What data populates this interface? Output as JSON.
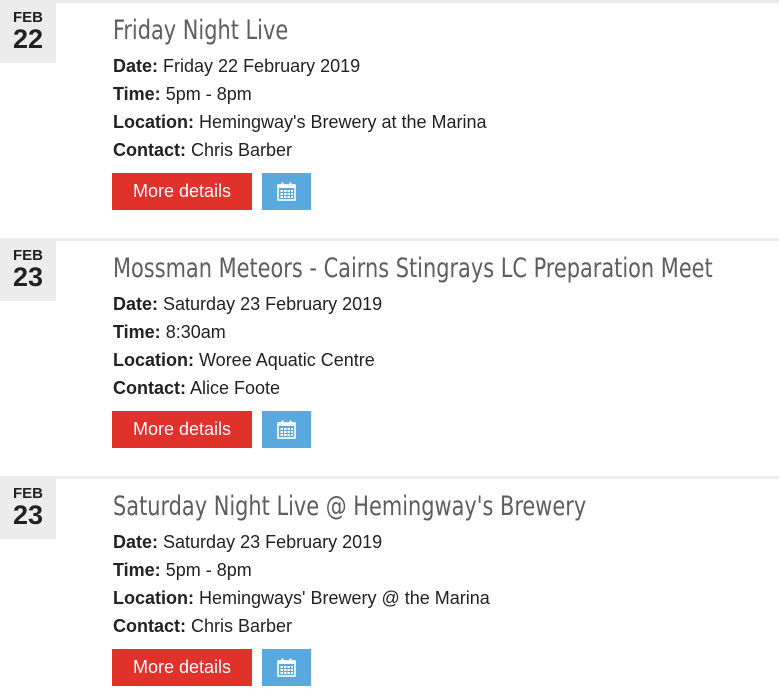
{
  "events": [
    {
      "month": "FEB",
      "day": "22",
      "title": "Friday Night Live",
      "date_label": "Date:",
      "date_value": "Friday 22 February 2019",
      "time_label": "Time:",
      "time_value": "5pm - 8pm",
      "location_label": "Location:",
      "location_value": "Hemingway's Brewery at the Marina",
      "contact_label": "Contact:",
      "contact_value": "Chris Barber",
      "more_label": "More details",
      "calendar_icon": "calendar-icon"
    },
    {
      "month": "FEB",
      "day": "23",
      "title": "Mossman Meteors - Cairns Stingrays LC Preparation Meet",
      "date_label": "Date:",
      "date_value": "Saturday 23 February 2019",
      "time_label": "Time:",
      "time_value": "8:30am",
      "location_label": "Location:",
      "location_value": "Woree Aquatic Centre",
      "contact_label": "Contact:",
      "contact_value": "Alice Foote",
      "more_label": "More details",
      "calendar_icon": "calendar-icon"
    },
    {
      "month": "FEB",
      "day": "23",
      "title": "Saturday Night Live @ Hemingway's Brewery",
      "date_label": "Date:",
      "date_value": "Saturday 23 February 2019",
      "time_label": "Time:",
      "time_value": "5pm - 8pm",
      "location_label": "Location:",
      "location_value": "Hemingways' Brewery @ the Marina",
      "contact_label": "Contact:",
      "contact_value": "Chris Barber",
      "more_label": "More details",
      "calendar_icon": "calendar-icon"
    }
  ],
  "colors": {
    "more_button": "#e0312b",
    "calendar_button": "#5aa9de",
    "date_badge": "#ececec",
    "title": "#5e5e5e"
  }
}
